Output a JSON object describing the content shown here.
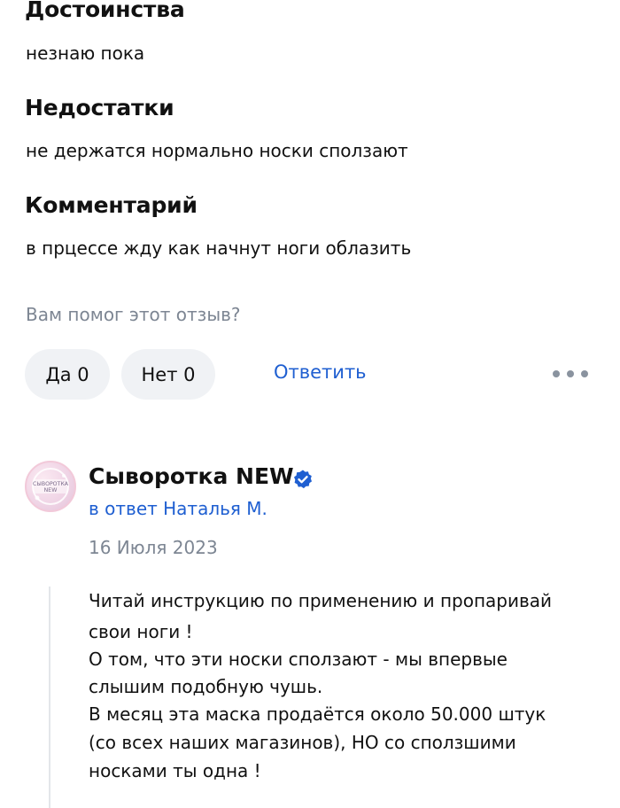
{
  "review": {
    "pros_heading": "Достоинства",
    "pros_text": "незнаю пока",
    "cons_heading": "Недостатки",
    "cons_text": "не держатся нормально носки сползают",
    "comment_heading": "Комментарий",
    "comment_text": "в прцессе жду как начнут ноги облазить",
    "helpful_question": "Вам помог этот отзыв?",
    "yes_label": "Да 0",
    "no_label": "Нет 0",
    "reply_label": "Ответить"
  },
  "reply": {
    "author": "Сыворотка NEW",
    "avatar_text": "СЫВОРОТКА NEW",
    "in_reply_to": "в ответ Наталья М.",
    "date": "16 Июля 2023",
    "lines": [
      "Читай инструкцию по применению и пропаривай",
      "свои ноги !",
      "О том, что эти носки сползают - мы впервые",
      "слышим подобную чушь.",
      "В месяц эта маска продаётся около 50.000 штук",
      "(со всех наших магазинов), НО со сползшими",
      "носками ты одна !"
    ]
  },
  "colors": {
    "accent": "#1f5fd1",
    "muted": "#7d8693",
    "pill_bg": "#f0f2f5",
    "verified_badge": "#1f5fd1"
  },
  "icons": {
    "more": "more-horizontal-icon",
    "verified": "verified-check-icon"
  }
}
